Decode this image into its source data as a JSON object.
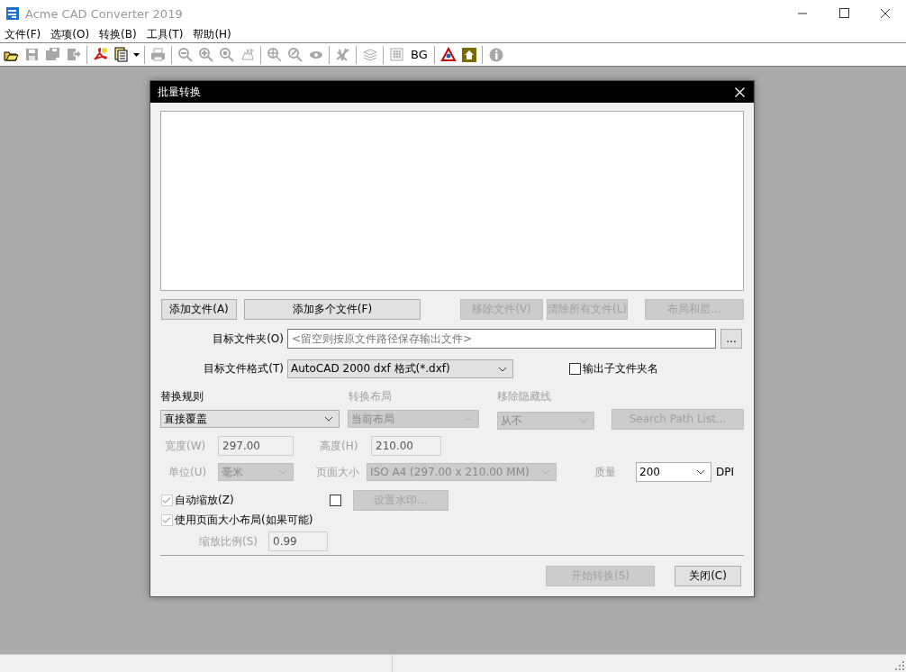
{
  "window": {
    "title": "Acme CAD Converter 2019"
  },
  "menu": [
    "文件(F)",
    "选项(O)",
    "转换(B)",
    "工具(T)",
    "帮助(H)"
  ],
  "toolbar": [
    {
      "kind": "icon",
      "disabled": false
    },
    {
      "kind": "icon",
      "disabled": true
    },
    {
      "kind": "icon",
      "disabled": true
    },
    {
      "kind": "icon",
      "disabled": true
    },
    {
      "kind": "separator"
    },
    {
      "kind": "icon",
      "disabled": false
    },
    {
      "kind": "icon",
      "disabled": false
    },
    {
      "kind": "separator"
    },
    {
      "kind": "icon",
      "disabled": true
    },
    {
      "kind": "separator"
    },
    {
      "kind": "icon",
      "disabled": true
    },
    {
      "kind": "icon",
      "disabled": true
    },
    {
      "kind": "icon",
      "disabled": true
    },
    {
      "kind": "icon",
      "disabled": true
    },
    {
      "kind": "separator"
    },
    {
      "kind": "icon",
      "disabled": true
    },
    {
      "kind": "icon",
      "disabled": true
    },
    {
      "kind": "icon",
      "disabled": true
    },
    {
      "kind": "separator"
    },
    {
      "kind": "icon",
      "disabled": true
    },
    {
      "kind": "separator"
    },
    {
      "kind": "icon",
      "disabled": true
    },
    {
      "kind": "separator"
    },
    {
      "kind": "icon",
      "disabled": true
    },
    {
      "kind": "text",
      "label": "BG",
      "disabled": false
    },
    {
      "kind": "separator"
    },
    {
      "kind": "icon",
      "disabled": false
    },
    {
      "kind": "icon",
      "disabled": false
    },
    {
      "kind": "separator"
    },
    {
      "kind": "icon",
      "disabled": true
    }
  ],
  "dialog": {
    "title": "批量转换",
    "file_buttons": [
      {
        "label": "添加文件(A)",
        "disabled": false
      },
      {
        "label": "添加多个文件(F)",
        "disabled": false
      },
      {
        "label": "移除文件(V)",
        "disabled": true
      },
      {
        "label": "清除所有文件(L)",
        "disabled": true
      },
      {
        "label": "布局和层...",
        "disabled": true
      }
    ],
    "target_folder": {
      "label": "目标文件夹(O)",
      "placeholder": "<留空则按原文件路径保存输出文件>",
      "browse_button": "..."
    },
    "target_format": {
      "label": "目标文件格式(T)",
      "value": "AutoCAD 2000 dxf 格式(*.dxf)"
    },
    "subfolder_checkbox": {
      "label": "输出子文件夹名",
      "checked": false
    },
    "replace_rule": {
      "label": "替换规则",
      "value": "直接覆盖",
      "disabled": false
    },
    "convert_layout": {
      "label": "转换布局",
      "value": "当前布局",
      "disabled": true
    },
    "remove_hidden_lines": {
      "label": "移除隐藏线",
      "value": "从不",
      "disabled": true
    },
    "search_path_button": {
      "label": "Search Path List...",
      "disabled": true
    },
    "width": {
      "label": "宽度(W)",
      "value": "297.00",
      "disabled": true
    },
    "height": {
      "label": "高度(H)",
      "value": "210.00",
      "disabled": true
    },
    "unit": {
      "label": "单位(U)",
      "value": "毫米",
      "disabled": true
    },
    "page_size": {
      "label": "页面大小",
      "value": "ISO A4 (297.00 x 210.00 MM)",
      "disabled": true
    },
    "quality": {
      "label": "质量",
      "label_disabled": true,
      "value": "200",
      "unit": "DPI",
      "disabled": false
    },
    "auto_scale": {
      "label": "自动缩放(Z)",
      "checked": true,
      "disabled": true
    },
    "watermark_checkbox": {
      "checked": false,
      "disabled": false
    },
    "watermark_button": {
      "label": "设置水印...",
      "disabled": true
    },
    "use_page_size_layout": {
      "label": "使用页面大小布局(如果可能)",
      "checked": true,
      "disabled": true
    },
    "scale_ratio": {
      "label": "缩放比例(S)",
      "value": "0.99",
      "disabled": true
    },
    "start_button": {
      "label": "开始转换(S)",
      "disabled": true
    },
    "close_button": {
      "label": "关闭(C)",
      "disabled": false
    }
  }
}
